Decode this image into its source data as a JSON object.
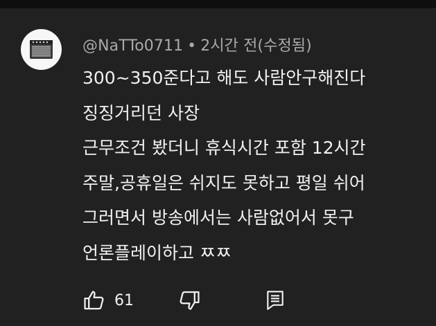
{
  "comment": {
    "author": "@NaTTo0711",
    "separator": "•",
    "time": "2시간 전(수정됨)",
    "lines": [
      "300~350준다고 해도 사람안구해진다",
      "징징거리던 사장",
      "근무조건 봤더니 휴식시간 포함 12시간",
      "주말,공휴일은 쉬지도 못하고 평일 쉬어",
      "그러면서 방송에서는 사람없어서 못구",
      "언론플레이하고 ㅉㅉ"
    ]
  },
  "actions": {
    "like_count": "61",
    "like_icon": "thumb-up-icon",
    "dislike_icon": "thumb-down-icon",
    "reply_icon": "comment-icon"
  },
  "colors": {
    "background": "#212121",
    "top_bar": "#0f0f0f",
    "primary_text": "#f1f1f1",
    "secondary_text": "#aaaaaa",
    "avatar_bg": "#f7f7f7"
  }
}
